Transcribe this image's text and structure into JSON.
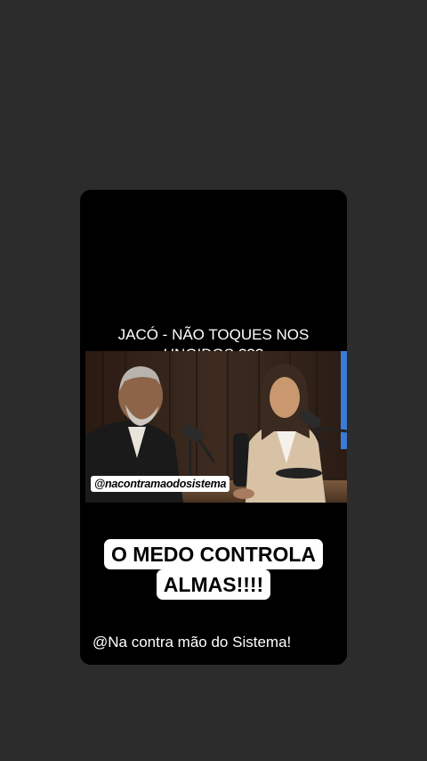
{
  "story": {
    "title_line1": "JACÓ - NÃO TOQUES NOS",
    "title_line2": "UNGIDOS ???",
    "video_watermark": "@nacontramaodosistema",
    "caption_line1": "O MEDO CONTROLA",
    "caption_line2": "ALMAS!!!!",
    "footer_handle": "@Na contra mão do Sistema!"
  },
  "colors": {
    "page_background": "#2c2c2c",
    "card_background": "#000000",
    "caption_background": "#ffffff"
  }
}
